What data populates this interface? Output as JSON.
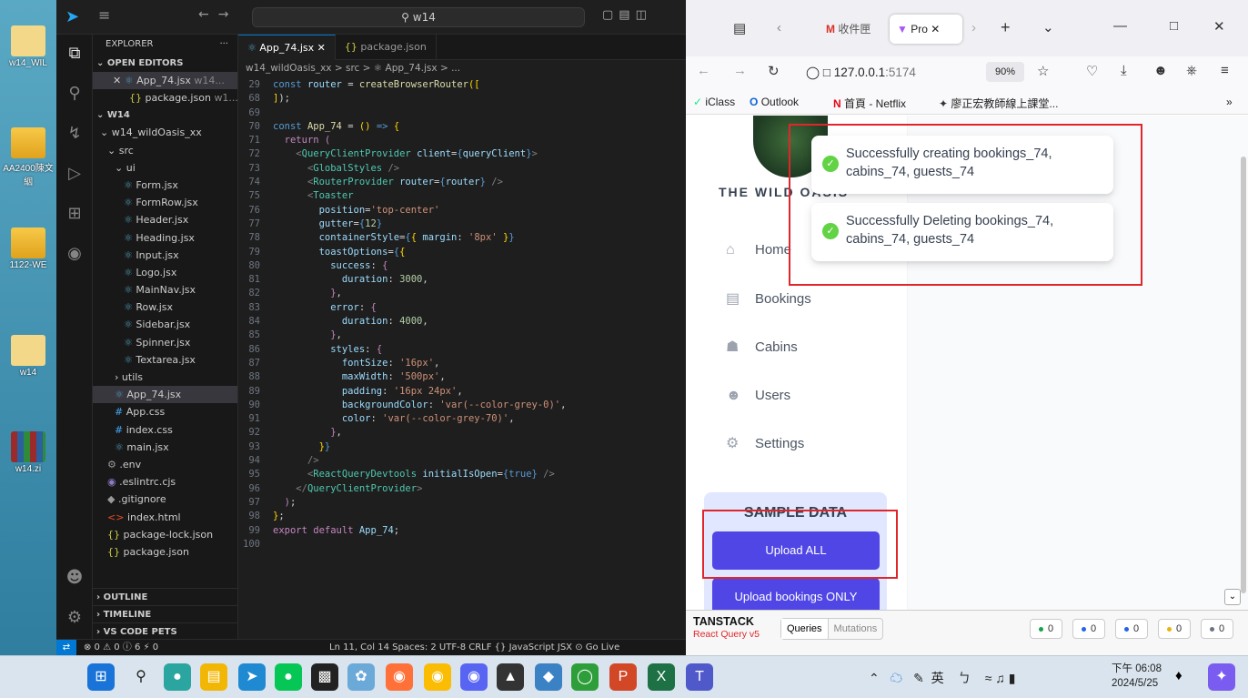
{
  "desktop": {
    "icons": [
      "w14_WIL",
      "AA2400陳文絪",
      "1122-WE",
      "w14",
      "w14.zi"
    ]
  },
  "vscode": {
    "search": "w14",
    "explorer_title": "EXPLORER",
    "open_editors_title": "OPEN EDITORS",
    "open_editors": [
      {
        "name": "App_74.jsx",
        "path": "w14...",
        "icon": "react-icon"
      },
      {
        "name": "package.json",
        "path": "w1...",
        "icon": "json-icon"
      }
    ],
    "workspace": "W14",
    "project_folder": "w14_wildOasis_xx",
    "src_folder": "src",
    "ui_folder": "ui",
    "ui_files": [
      "Form.jsx",
      "FormRow.jsx",
      "Header.jsx",
      "Heading.jsx",
      "Input.jsx",
      "Logo.jsx",
      "MainNav.jsx",
      "Row.jsx",
      "Sidebar.jsx",
      "Spinner.jsx",
      "Textarea.jsx"
    ],
    "utils_folder": "utils",
    "src_files": [
      {
        "name": "App_74.jsx",
        "icon": "react-icon",
        "cls": "ico-react"
      },
      {
        "name": "App.css",
        "icon": "css-icon",
        "cls": "ico-css"
      },
      {
        "name": "index.css",
        "icon": "css-icon",
        "cls": "ico-css"
      },
      {
        "name": "main.jsx",
        "icon": "react-icon",
        "cls": "ico-react"
      }
    ],
    "root_files": [
      {
        "name": ".env",
        "icon": "gear-icon",
        "cls": "ico-env"
      },
      {
        "name": ".eslintrc.cjs",
        "icon": "eslint-icon",
        "cls": "ico-es"
      },
      {
        "name": ".gitignore",
        "icon": "git-icon",
        "cls": "ico-env"
      },
      {
        "name": "index.html",
        "icon": "html-icon",
        "cls": "ico-html"
      },
      {
        "name": "package-lock.json",
        "icon": "json-icon",
        "cls": "ico-json"
      },
      {
        "name": "package.json",
        "icon": "json-icon",
        "cls": "ico-json"
      }
    ],
    "bottom_sections": [
      "OUTLINE",
      "TIMELINE",
      "VS CODE PETS"
    ],
    "tabs": [
      {
        "label": "App_74.jsx",
        "close": "✕"
      },
      {
        "label": "package.json"
      }
    ],
    "breadcrumb": "w14_wildOasis_xx > src > ⚛ App_74.jsx > ...",
    "status": {
      "problems": "⊗ 0 ⚠ 0 ⓘ 6",
      "ports": "⚡ 0",
      "right": "Ln 11, Col 14   Spaces: 2   UTF-8   CRLF   {} JavaScript JSX   ⊙ Go Live"
    }
  },
  "browser": {
    "tab_gmail": "收件匣",
    "tab_active": "Pro",
    "url_host": "127.0.0.1",
    "url_port": ":5174",
    "zoom": "90%",
    "bookmarks": [
      "iClass",
      "Outlook",
      "首頁 - Netflix",
      "廖正宏教師線上課堂..."
    ],
    "logo_text": "THE WILD OASIS",
    "nav": [
      "Home",
      "Bookings",
      "Cabins",
      "Users",
      "Settings"
    ],
    "sample_title": "SAMPLE DATA",
    "upload_all": "Upload ALL",
    "upload_bookings": "Upload bookings ONLY",
    "toasts": [
      "Successfully creating bookings_74, cabins_74, guests_74",
      "Successfully Deleting bookings_74, cabins_74, guests_74"
    ],
    "tanstack": {
      "brand": "TANSTACK",
      "sub": "React Query v5",
      "tabs": [
        "Queries",
        "Mutations"
      ],
      "counts": [
        {
          "value": "0",
          "color": "#16a34a"
        },
        {
          "value": "0",
          "color": "#2563eb"
        },
        {
          "value": "0",
          "color": "#2563eb"
        },
        {
          "value": "0",
          "color": "#eab308"
        },
        {
          "value": "0",
          "color": "#6b7280"
        }
      ]
    }
  },
  "taskbar": {
    "ime": "英",
    "ime2": "ㄅ",
    "time": "下午 06:08",
    "date": "2024/5/25"
  }
}
